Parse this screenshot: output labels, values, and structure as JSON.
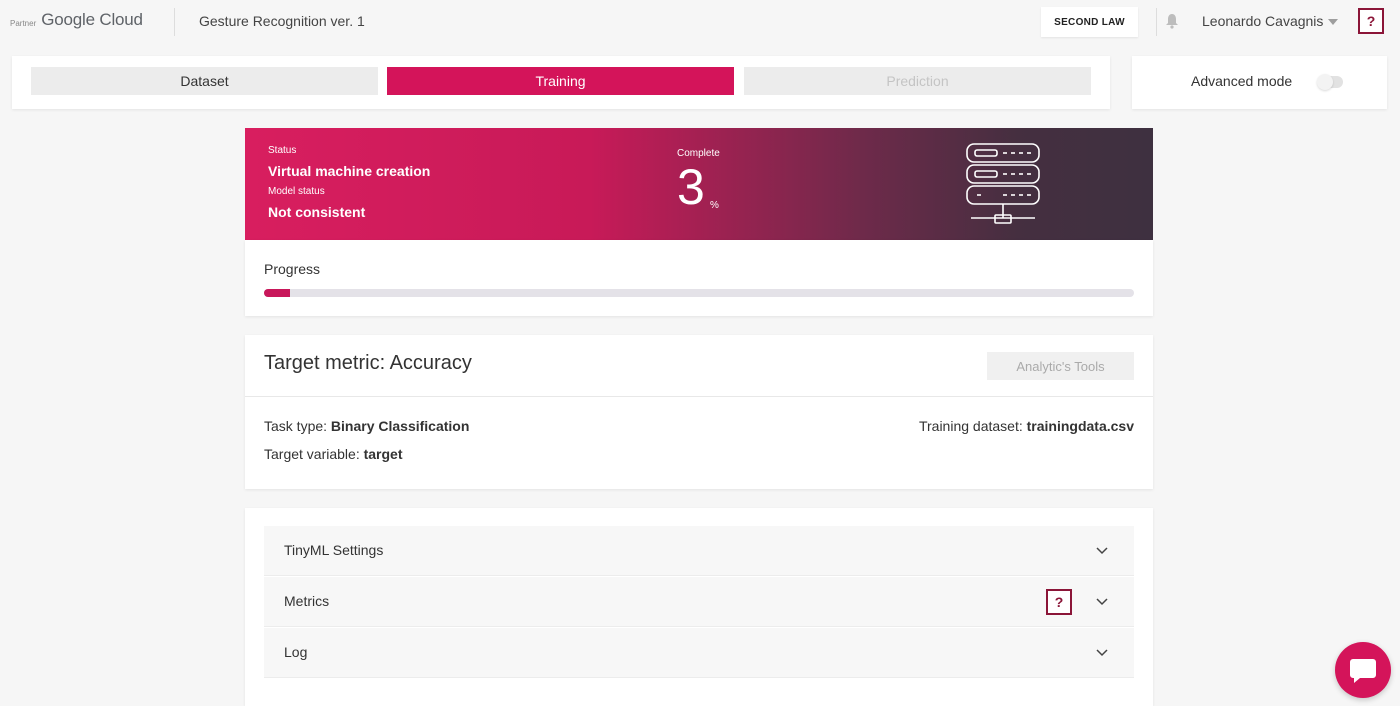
{
  "header": {
    "brand_partner": "Partner",
    "brand_name": "Google Cloud",
    "project_title": "Gesture Recognition ver. 1",
    "org_button": "SECOND LAW",
    "user_name": "Leonardo Cavagnis",
    "help_label": "?"
  },
  "tabs": [
    {
      "label": "Dataset",
      "state": "default"
    },
    {
      "label": "Training",
      "state": "active"
    },
    {
      "label": "Prediction",
      "state": "disabled"
    }
  ],
  "advanced_mode": {
    "label": "Advanced mode",
    "enabled": false
  },
  "status": {
    "status_label": "Status",
    "status_value": "Virtual machine creation",
    "model_label": "Model status",
    "model_value": "Not consistent",
    "complete_label": "Complete",
    "complete_value": "3",
    "complete_unit": "%"
  },
  "progress": {
    "label": "Progress",
    "fraction": 0.03
  },
  "metric": {
    "title": "Target metric:  Accuracy",
    "analytics_button": "Analytic's Tools",
    "task_type_label": "Task type:",
    "task_type_value": "Binary Classification",
    "target_var_label": "Target variable:",
    "target_var_value": "target",
    "dataset_label": "Training dataset:",
    "dataset_value": "trainingdata.csv"
  },
  "accordion": [
    {
      "label": "TinyML Settings"
    },
    {
      "label": "Metrics",
      "help": "?"
    },
    {
      "label": "Log"
    }
  ],
  "colors": {
    "accent": "#d4145a",
    "help_border": "#8b1538",
    "banner_dark": "#3e3040"
  }
}
